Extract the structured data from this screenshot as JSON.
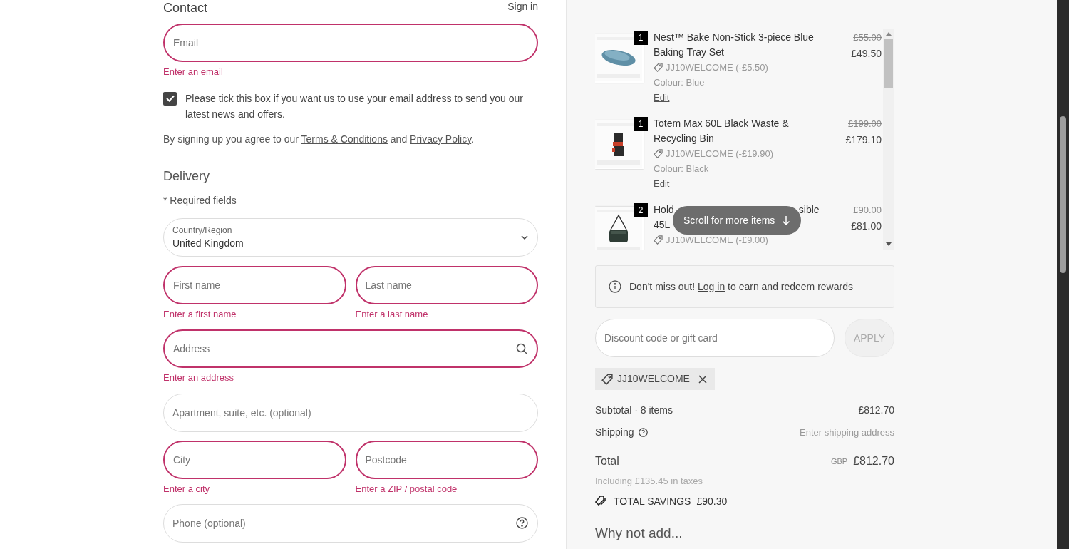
{
  "contact": {
    "heading": "Contact",
    "sign_in": "Sign in",
    "email": {
      "placeholder": "Email",
      "error": "Enter an email"
    },
    "newsletter": {
      "checked": true,
      "label": "Please tick this box if you want us to use your email address to send you our latest news and offers."
    },
    "terms": {
      "before": "By signing up you agree to our ",
      "terms_link": "Terms & Conditions",
      "middle": " and ",
      "privacy_link": "Privacy Policy",
      "after": "."
    }
  },
  "delivery": {
    "heading": "Delivery",
    "required_note": "* Required fields",
    "country": {
      "label": "Country/Region",
      "value": "United Kingdom"
    },
    "rows": [
      [
        {
          "placeholder": "First name",
          "error": "Enter a first name"
        },
        {
          "placeholder": "Last name",
          "error": "Enter a last name"
        }
      ],
      [
        {
          "placeholder": "Address",
          "error": "Enter an address"
        }
      ],
      [
        {
          "placeholder": "Apartment, suite, etc. (optional)"
        }
      ],
      [
        {
          "placeholder": "City",
          "error": "Enter a city"
        },
        {
          "placeholder": "Postcode",
          "error": "Enter a ZIP / postal code"
        }
      ],
      [
        {
          "placeholder": "Phone (optional)"
        }
      ]
    ]
  },
  "order": {
    "items": [
      {
        "qty": "1",
        "name_lines": [
          "Nest™ Bake Non-Stick 3-piece Blue",
          "Baking Tray Set"
        ],
        "discount": "JJ10WELCOME (-£5.50)",
        "colour": "Colour: Blue",
        "edit": "Edit",
        "old_price": "£55.00",
        "price": "£49.50"
      },
      {
        "qty": "1",
        "name_lines": [
          "Totem Max 60L Black Waste &",
          "Recycling Bin"
        ],
        "discount": "JJ10WELCOME (-£19.90)",
        "colour": "Colour: Black",
        "edit": "Edit",
        "old_price": "£199.00",
        "price": "£179.10"
      },
      {
        "qty": "2",
        "name_lines": [
          "Hold",
          "sible",
          "45L"
        ],
        "discount": "JJ10WELCOME (-£9.00)",
        "old_price": "£90.00",
        "price": "£81.00"
      }
    ],
    "scroll_hint": "Scroll for more items",
    "rewards": {
      "before": "Don't miss out! ",
      "link": "Log in",
      "after": " to earn and redeem rewards"
    },
    "discount_field": {
      "placeholder": "Discount code or gift card"
    },
    "apply": {
      "label": "APPLY",
      "disabled": true
    },
    "applied_code": "JJ10WELCOME",
    "subtotal": {
      "label": "Subtotal · 8 items",
      "value": "£812.70"
    },
    "shipping": {
      "label": "Shipping",
      "value": "Enter shipping address"
    },
    "total": {
      "label": "Total",
      "currency": "GBP",
      "value": "£812.70",
      "taxes": "Including £135.45 in taxes"
    },
    "savings": {
      "label": "TOTAL SAVINGS",
      "value": "£90.30"
    },
    "upsell_heading": "Why not add..."
  }
}
